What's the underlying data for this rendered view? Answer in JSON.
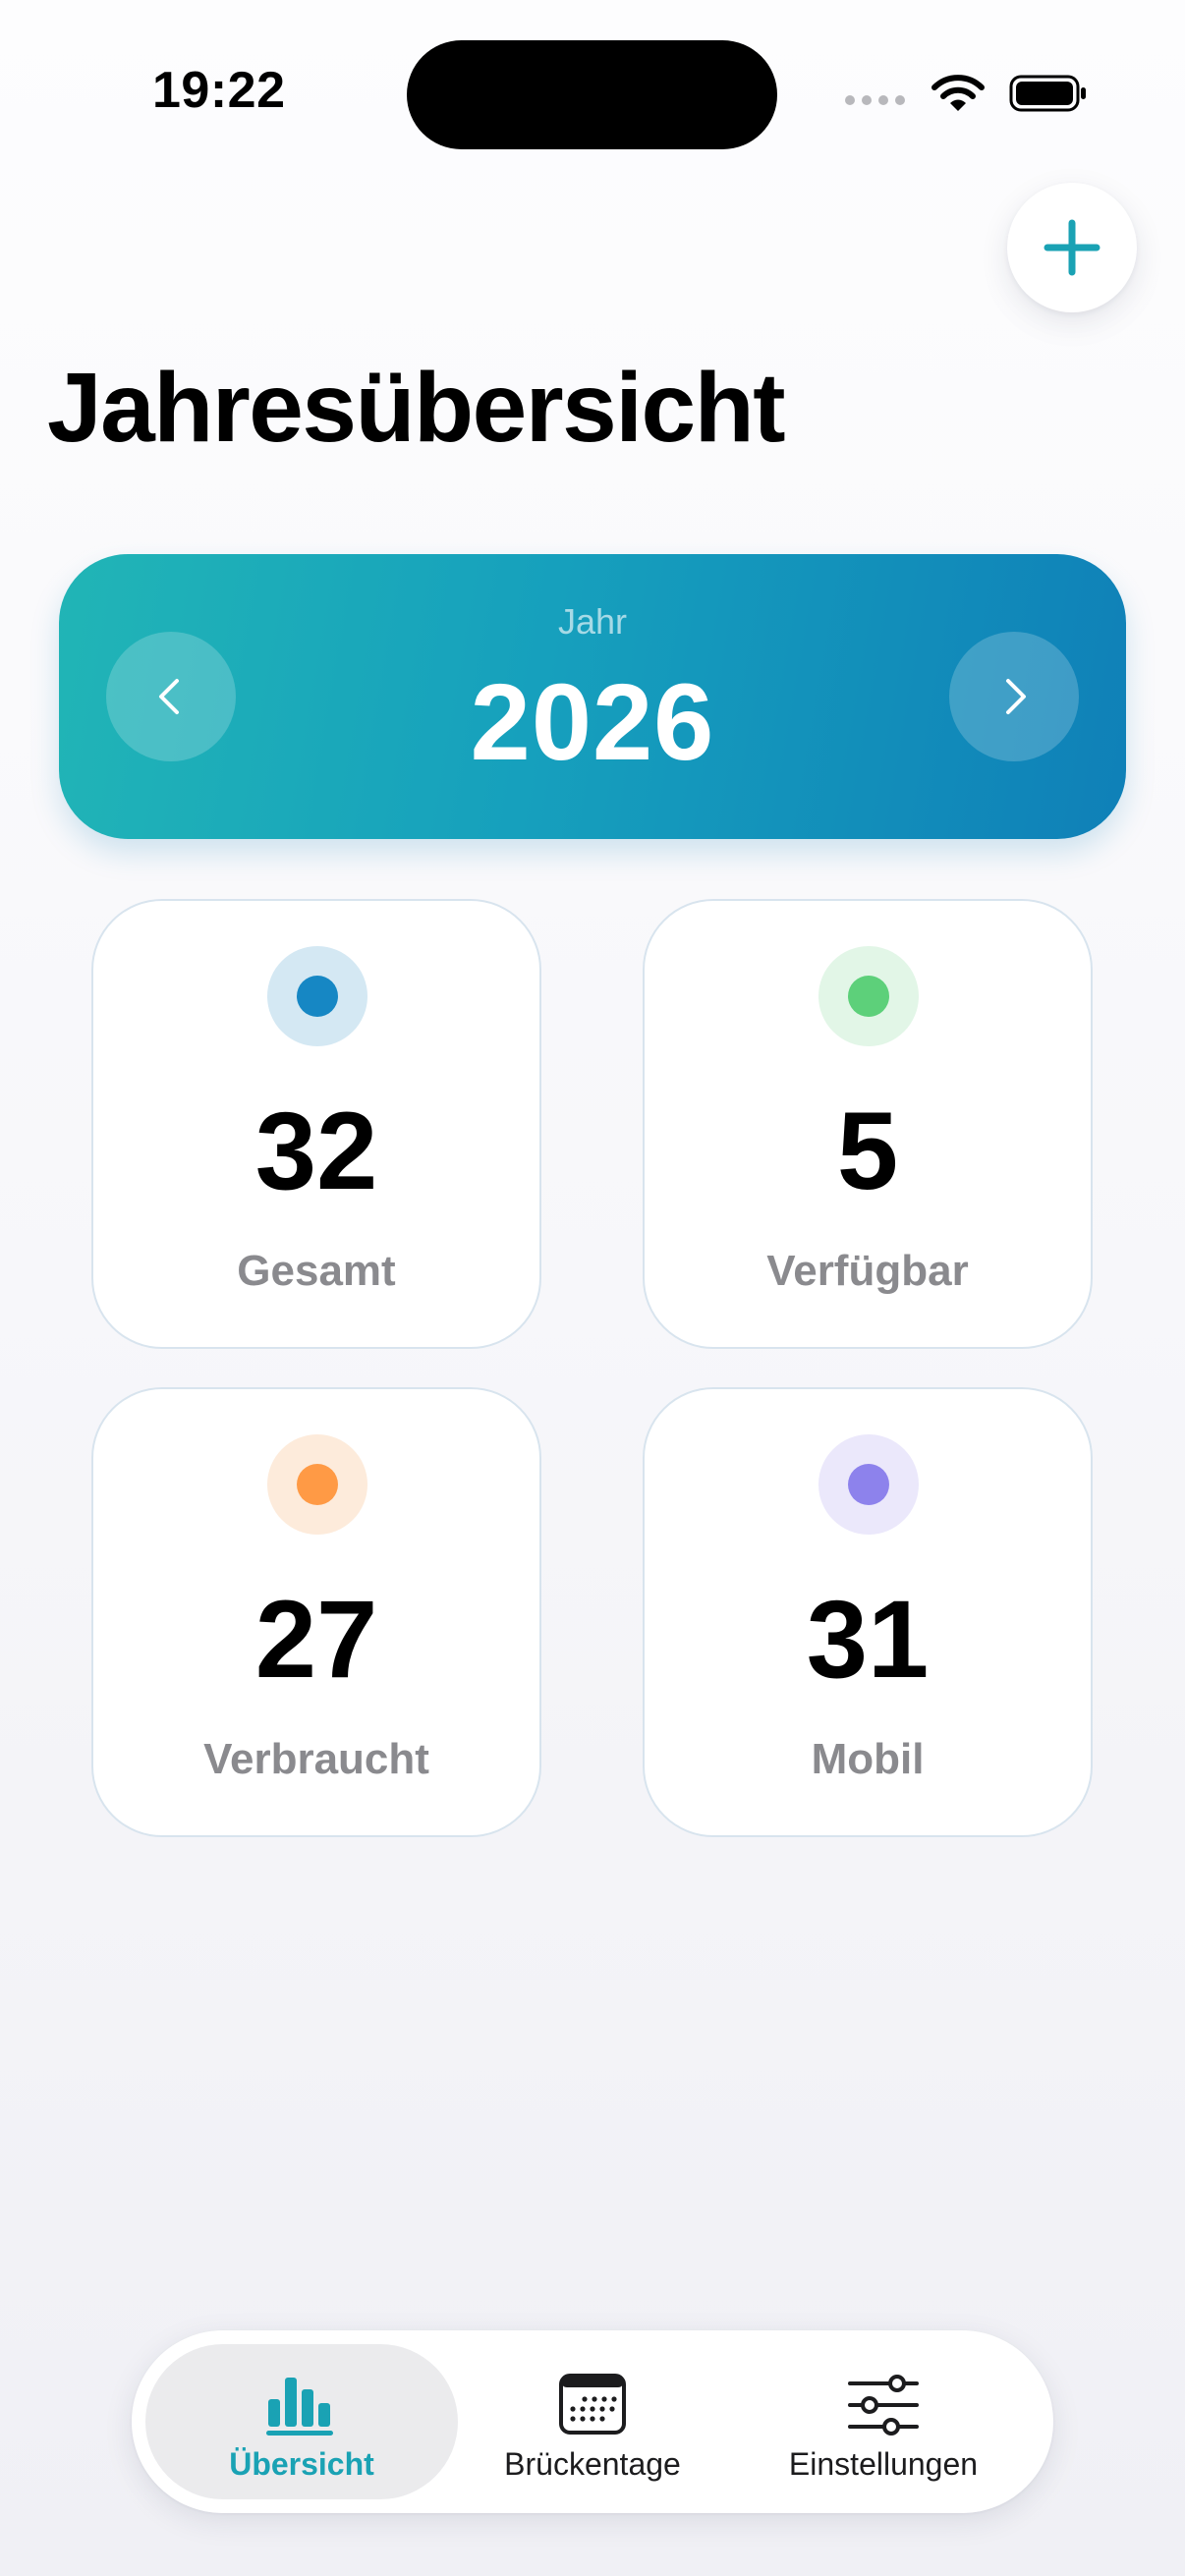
{
  "status_bar": {
    "time": "19:22",
    "icons": [
      "signal-dots-icon",
      "wifi-icon",
      "battery-icon"
    ]
  },
  "header": {
    "add_icon": "plus-icon",
    "title": "Jahresübersicht"
  },
  "year_selector": {
    "label": "Jahr",
    "value": "2026",
    "prev_icon": "chevron-left-icon",
    "next_icon": "chevron-right-icon"
  },
  "stats": [
    {
      "value": "32",
      "label": "Gesamt",
      "dot_color": "#1687c4",
      "ring_color": "#d4e8f3"
    },
    {
      "value": "5",
      "label": "Verfügbar",
      "dot_color": "#5dd07a",
      "ring_color": "#e2f6e7"
    },
    {
      "value": "27",
      "label": "Verbraucht",
      "dot_color": "#ff9a45",
      "ring_color": "#fdebdb"
    },
    {
      "value": "31",
      "label": "Mobil",
      "dot_color": "#8d82ec",
      "ring_color": "#ebe8fb"
    }
  ],
  "tabs": [
    {
      "label": "Übersicht",
      "icon": "bar-chart-icon",
      "active": true
    },
    {
      "label": "Brückentage",
      "icon": "calendar-icon",
      "active": false
    },
    {
      "label": "Einstellungen",
      "icon": "sliders-icon",
      "active": false
    }
  ],
  "colors": {
    "accent": "#1aa2b4",
    "year_card_start": "#21b5b6",
    "year_card_end": "#0f80b8"
  }
}
